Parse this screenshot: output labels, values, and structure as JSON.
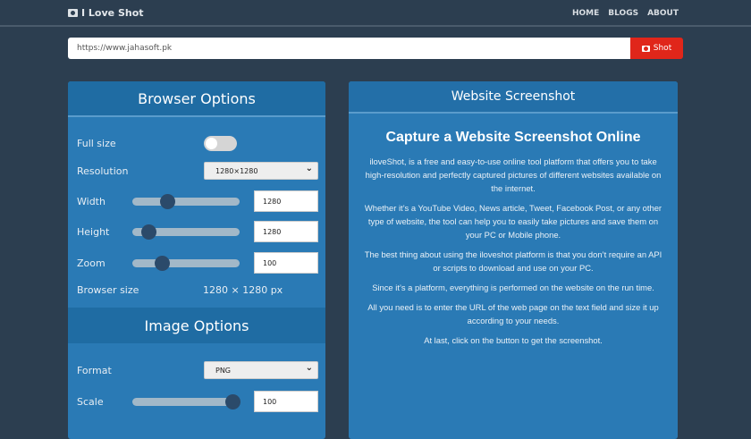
{
  "brand": "I Love Shot",
  "nav": [
    "HOME",
    "BLOGS",
    "ABOUT"
  ],
  "url_value": "https://www.jahasoft.pk",
  "shot_label": "Shot",
  "browser": {
    "title": "Browser Options",
    "full_size": "Full size",
    "full_size_on": false,
    "resolution_label": "Resolution",
    "resolution": "1280×1280",
    "width_label": "Width",
    "width": "1280",
    "width_slider": 0.3,
    "height_label": "Height",
    "height": "1280",
    "height_slider": 0.1,
    "zoom_label": "Zoom",
    "zoom": "100",
    "zoom_slider": 0.24,
    "size_label": "Browser size",
    "size": "1280 × 1280 px"
  },
  "image": {
    "title": "Image Options",
    "format_label": "Format",
    "format": "PNG",
    "scale_label": "Scale",
    "scale": "100",
    "scale_slider": 1.0
  },
  "right": {
    "title": "Website Screenshot",
    "heading": "Capture a Website Screenshot Online",
    "paragraphs": [
      "iloveShot, is a free and easy-to-use online tool platform that offers you to take high-resolution and perfectly captured pictures of different websites available on the internet.",
      "Whether it’s a YouTube Video, News article, Tweet, Facebook Post, or any other type of website, the tool can help you to easily take pictures and save them on your PC or Mobile phone.",
      "The best thing about using the iloveshot platform is that you don’t require an API or scripts to download and use on your PC.",
      "Since it’s a platform, everything is performed on the website on the run time.",
      "All you need is to enter the URL of the web page on the text field and size it up according to your needs.",
      "At last, click on the button to get the screenshot."
    ]
  }
}
